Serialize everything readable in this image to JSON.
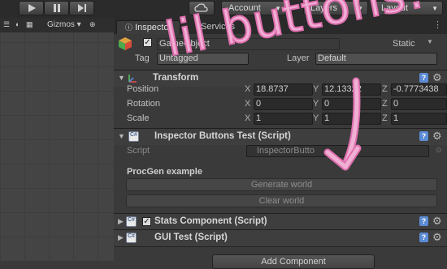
{
  "toolbar": {
    "account_label": "Account",
    "layers_label": "Layers",
    "layout_label": "Layout"
  },
  "scene": {
    "gizmos_label": "Gizmos"
  },
  "tabs": [
    {
      "label": "Inspector"
    },
    {
      "label": "Services"
    }
  ],
  "gameobject": {
    "name": "GameObject",
    "static_label": "Static",
    "tag_label": "Tag",
    "tag_value": "Untagged",
    "layer_label": "Layer",
    "layer_value": "Default"
  },
  "transform": {
    "title": "Transform",
    "position": {
      "label": "Position",
      "x": "18.8737",
      "y": "12.13322",
      "z": "-0.7773438"
    },
    "rotation": {
      "label": "Rotation",
      "x": "0",
      "y": "0",
      "z": "0"
    },
    "scale": {
      "label": "Scale",
      "x": "1",
      "y": "1",
      "z": "1"
    }
  },
  "components": {
    "inspector_buttons": {
      "title": "Inspector Buttons Test (Script)",
      "script_label": "Script",
      "script_value": "InspectorButto",
      "section_label": "ProcGen example",
      "generate_label": "Generate world",
      "clear_label": "Clear world"
    },
    "stats": {
      "title": "Stats Component (Script)"
    },
    "gui_test": {
      "title": "GUI Test (Script)"
    }
  },
  "add_component_label": "Add Component",
  "annotation": "lil buttons!",
  "axis_labels": {
    "x": "X",
    "y": "Y",
    "z": "Z"
  },
  "colors": {
    "annotation": "#f0b0d4",
    "help_icon": "#5b8bd4"
  }
}
